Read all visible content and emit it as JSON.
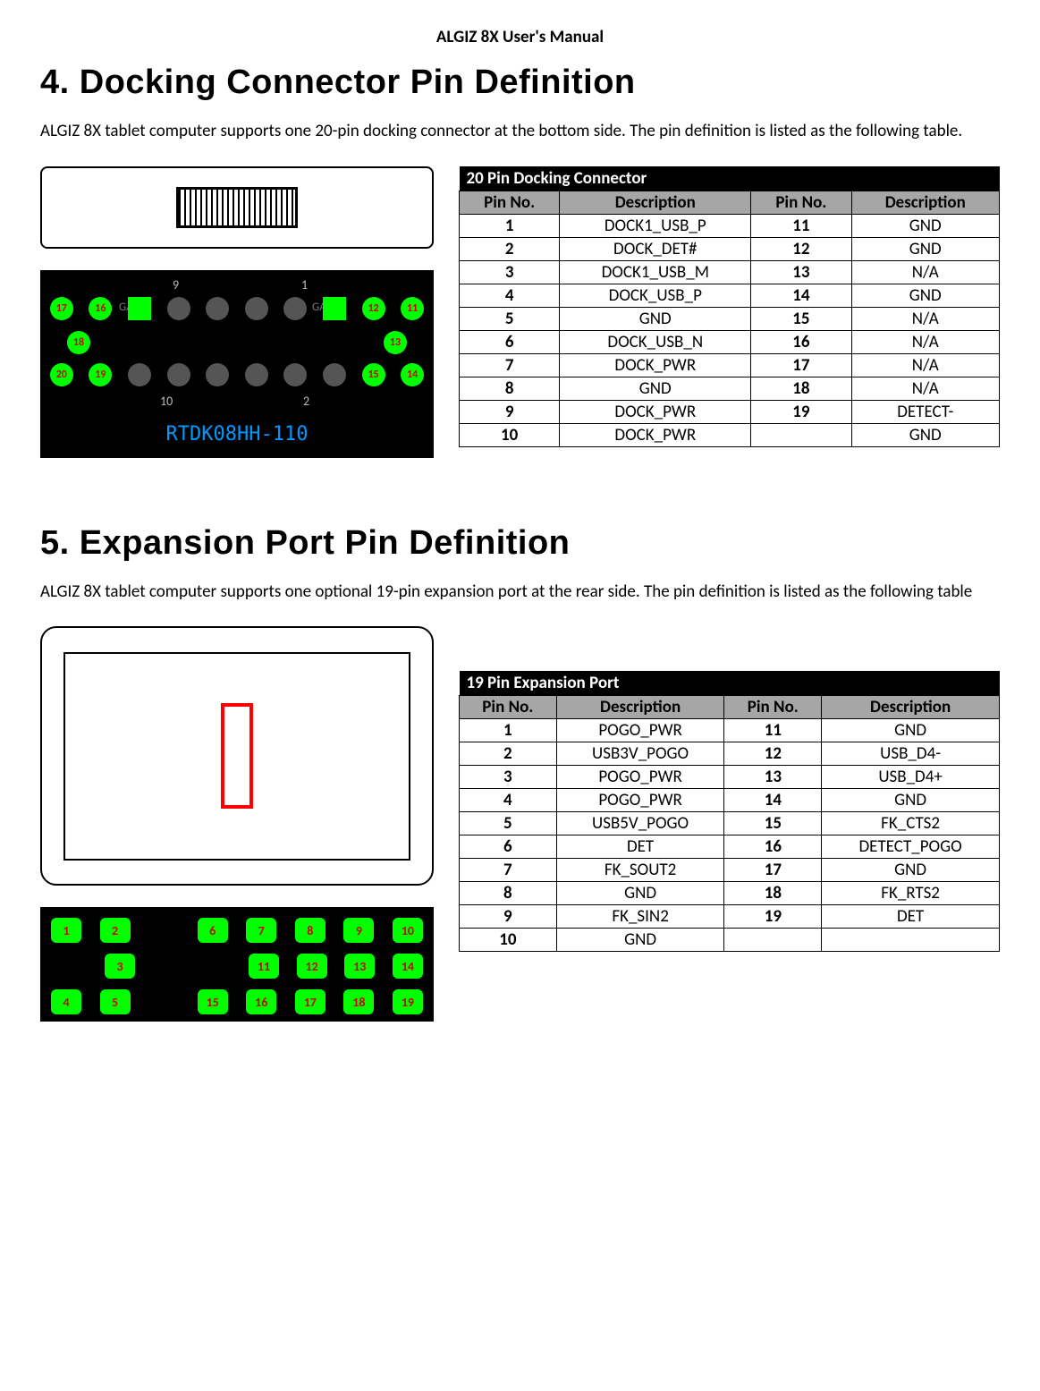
{
  "header": "ALGIZ 8X User's Manual",
  "section4": {
    "title": "4.  Docking Connector Pin Definition",
    "intro": "ALGIZ 8X tablet computer supports one 20-pin docking connector at the bottom side. The pin definition is listed as the following table.",
    "part_label": "RTDK08HH-110",
    "pcb_top_row": [
      "17",
      "16",
      "",
      "",
      "",
      "",
      "",
      "",
      "12",
      "11"
    ],
    "pcb_mid_row": [
      "18",
      "",
      "",
      "",
      "",
      "",
      "",
      "",
      "",
      "13"
    ],
    "pcb_bot_row": [
      "20",
      "19",
      "",
      "",
      "",
      "",
      "",
      "",
      "15",
      "14"
    ],
    "pcb_num_top": "9",
    "pcb_num_bot": "1",
    "pcb_num_top2": "1",
    "pcb_num_bot2": "2",
    "pcb_num_left_alt": "10",
    "silk1": "GA2",
    "silk2": "GA3"
  },
  "section5": {
    "title": "5.  Expansion Port Pin Definition",
    "intro": "ALGIZ 8X tablet computer supports one optional 19-pin expansion port at the rear side. The pin definition is listed as the following table",
    "pcb_row1": [
      "1",
      "2",
      "6",
      "7",
      "8",
      "9",
      "10"
    ],
    "pcb_row2": [
      "3",
      "11",
      "12",
      "13",
      "14"
    ],
    "pcb_row3": [
      "4",
      "5",
      "15",
      "16",
      "17",
      "18",
      "19"
    ]
  },
  "tables": {
    "docking": {
      "title": "20 Pin Docking Connector",
      "cols": [
        "Pin No.",
        "Description",
        "Pin No.",
        "Description"
      ],
      "rows": [
        [
          "1",
          "DOCK1_USB_P",
          "11",
          "GND"
        ],
        [
          "2",
          "DOCK_DET#",
          "12",
          "GND"
        ],
        [
          "3",
          "DOCK1_USB_M",
          "13",
          "N/A"
        ],
        [
          "4",
          "DOCK_USB_P",
          "14",
          "GND"
        ],
        [
          "5",
          "GND",
          "15",
          "N/A"
        ],
        [
          "6",
          "DOCK_USB_N",
          "16",
          "N/A"
        ],
        [
          "7",
          "DOCK_PWR",
          "17",
          "N/A"
        ],
        [
          "8",
          "GND",
          "18",
          "N/A"
        ],
        [
          "9",
          "DOCK_PWR",
          "19",
          "DETECT-"
        ],
        [
          "10",
          "DOCK_PWR",
          "",
          "GND"
        ]
      ]
    },
    "expansion": {
      "title": "19 Pin Expansion Port",
      "cols": [
        "Pin No.",
        "Description",
        "Pin No.",
        "Description"
      ],
      "rows": [
        [
          "1",
          "POGO_PWR",
          "11",
          "GND"
        ],
        [
          "2",
          "USB3V_POGO",
          "12",
          "USB_D4-"
        ],
        [
          "3",
          "POGO_PWR",
          "13",
          "USB_D4+"
        ],
        [
          "4",
          "POGO_PWR",
          "14",
          "GND"
        ],
        [
          "5",
          "USB5V_POGO",
          "15",
          "FK_CTS2"
        ],
        [
          "6",
          "DET",
          "16",
          "DETECT_POGO"
        ],
        [
          "7",
          "FK_SOUT2",
          "17",
          "GND"
        ],
        [
          "8",
          "GND",
          "18",
          "FK_RTS2"
        ],
        [
          "9",
          "FK_SIN2",
          "19",
          "DET"
        ],
        [
          "10",
          "GND",
          "",
          ""
        ]
      ]
    }
  }
}
